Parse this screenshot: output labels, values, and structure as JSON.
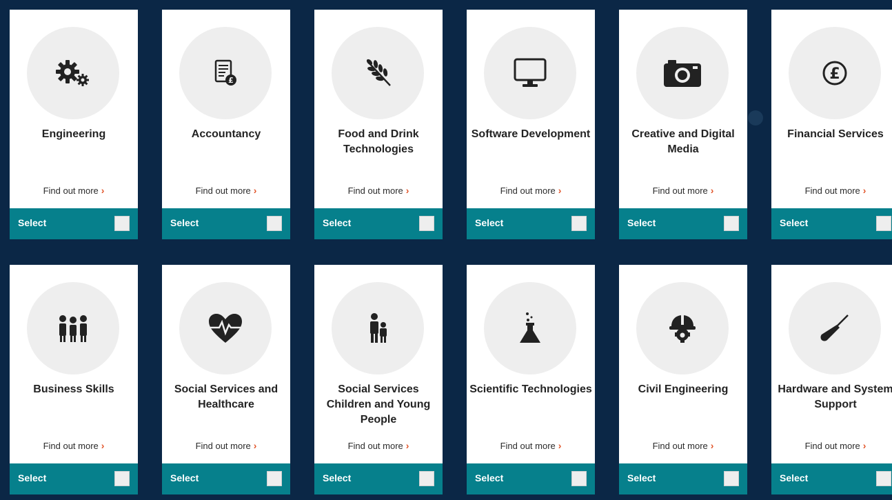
{
  "find_out_more": "Find out more",
  "chevron": "›",
  "select_label": "Select",
  "colors": {
    "background": "#0b2746",
    "select_bar": "#06808c",
    "chevron": "#e2562b",
    "icon_circle": "#eeeeee"
  },
  "cards": [
    {
      "title": "Engineering",
      "icon": "gears-icon"
    },
    {
      "title": "Accountancy",
      "icon": "accounts-document-icon"
    },
    {
      "title": "Food and Drink Technologies",
      "icon": "wheat-icon"
    },
    {
      "title": "Software Development",
      "icon": "monitor-icon"
    },
    {
      "title": "Creative and Digital Media",
      "icon": "camera-icon"
    },
    {
      "title": "Financial Services",
      "icon": "pound-coin-icon"
    },
    {
      "title": "Business Skills",
      "icon": "people-group-icon"
    },
    {
      "title": "Social Services and Healthcare",
      "icon": "heart-pulse-icon"
    },
    {
      "title": "Social Services Children and Young People",
      "icon": "parent-child-icon"
    },
    {
      "title": "Scientific Technologies",
      "icon": "flask-icon"
    },
    {
      "title": "Civil Engineering",
      "icon": "hardhat-gear-icon"
    },
    {
      "title": "Hardware and System Support",
      "icon": "screwdriver-icon"
    }
  ]
}
